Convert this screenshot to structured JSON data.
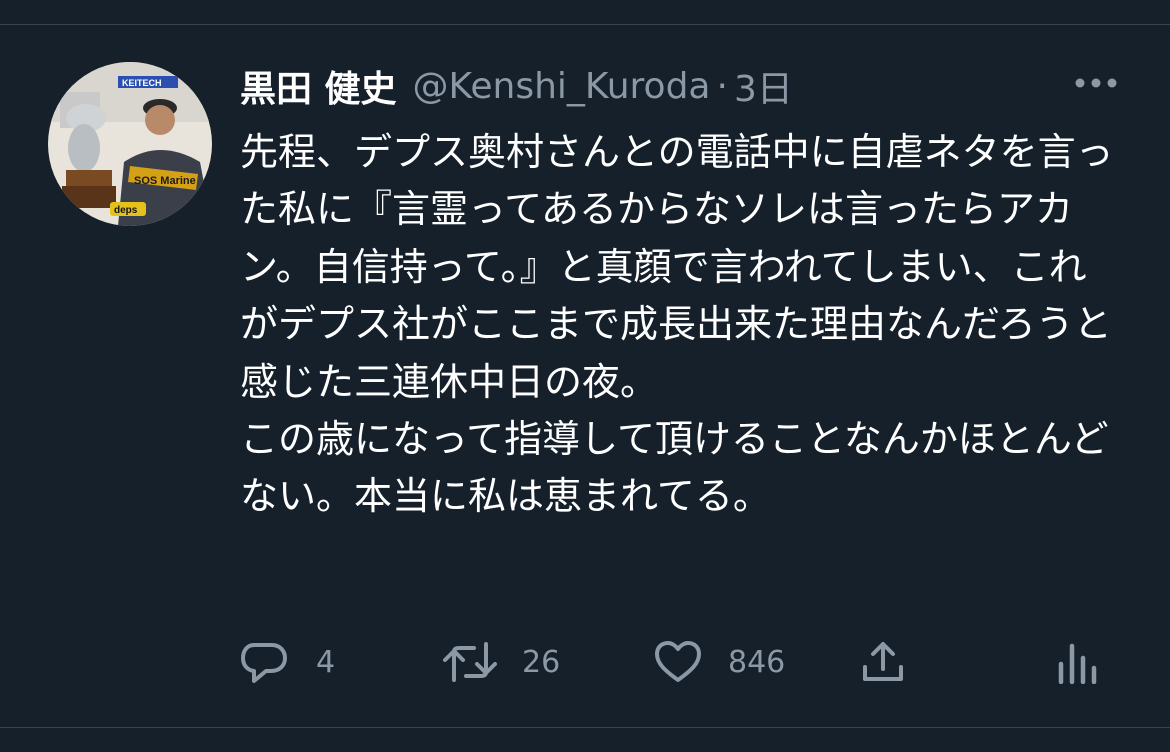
{
  "tweet": {
    "display_name": "黒田 健史",
    "handle": "@Kenshi_Kuroda",
    "separator": "·",
    "time": "3日",
    "text": "先程、デプス奥村さんとの電話中に自虐ネタを言った私に『言霊ってあるからなソレは言ったらアカン。自信持って。』と真顔で言われてしまい、これがデプス社がここまで成長出来た理由なんだろうと感じた三連休中日の夜。\nこの歳になって指導して頂けることなんかほとんどない。本当に私は恵まれてる。",
    "avatar_text": {
      "banner": "KEITECH",
      "jersey": "SOS Marine",
      "hat": "deps"
    }
  },
  "actions": {
    "reply_icon": "reply-icon",
    "reply_count": "4",
    "retweet_icon": "retweet-icon",
    "retweet_count": "26",
    "like_icon": "heart-icon",
    "like_count": "846",
    "share_icon": "share-icon",
    "analytics_icon": "analytics-icon"
  },
  "colors": {
    "background": "#15202b",
    "text_primary": "#ffffff",
    "text_secondary": "#8b98a5",
    "divider": "#38444d"
  }
}
